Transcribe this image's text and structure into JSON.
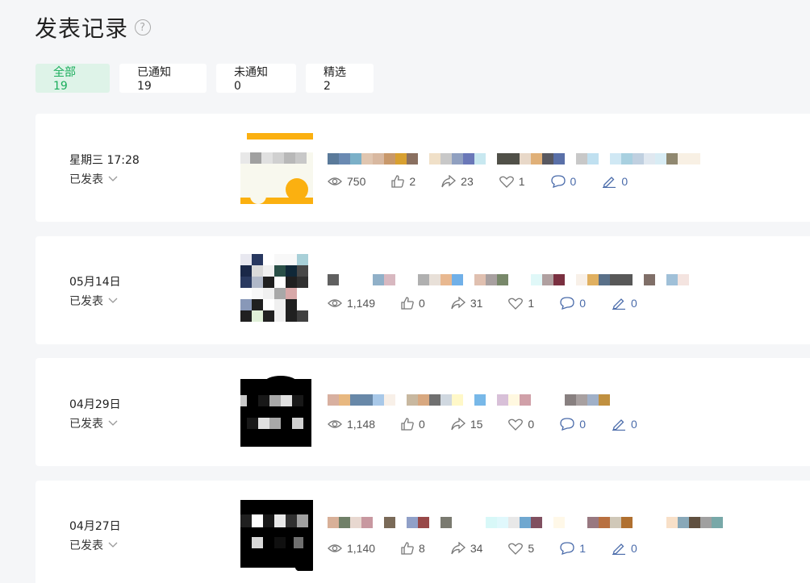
{
  "page": {
    "title": "发表记录",
    "help_glyph": "?"
  },
  "tabs": [
    {
      "label": "全部 19",
      "active": true
    },
    {
      "label": "已通知 19",
      "active": false
    },
    {
      "label": "未通知 0",
      "active": false
    },
    {
      "label": "精选 2",
      "active": false
    }
  ],
  "posts": [
    {
      "date": "星期三 17:28",
      "status": "已发表",
      "stats": {
        "views": "750",
        "likes": "2",
        "shares": "23",
        "favorites": "1",
        "comments": "0",
        "notes": "0"
      },
      "title_colors": [
        "#5a7a9a",
        "#6a8ab2",
        "#7bb0c8",
        "#e0c6b0",
        "#d8b8a0",
        "#c8986a",
        "#d8a030",
        "#8a7060",
        "#fff",
        "#f0e0c8",
        "#c8c8c8",
        "#90a0c0",
        "#6a78b8",
        "#c8e8f0",
        "#fff",
        "#505048",
        "#505048",
        "#e8d8c8",
        "#e0b078",
        "#585860",
        "#5a70a8",
        "#fff",
        "#c8c8c8",
        "#c0e0f0",
        "#fff",
        "#d0e8f4",
        "#a8d0e0",
        "#c0d0e0",
        "#e0e8f0",
        "#d8ecf4",
        "#908870",
        "#f8f0e4",
        "#f8f0e4"
      ]
    },
    {
      "date": "05月14日",
      "status": "已发表",
      "stats": {
        "views": "1,149",
        "likes": "0",
        "shares": "31",
        "favorites": "1",
        "comments": "0",
        "notes": "0"
      },
      "title_colors": [
        "#606060",
        "#fff",
        "#fff",
        "#fff",
        "#90b0c8",
        "#d8b8c0",
        "#fff",
        "#fff",
        "#b0b0b0",
        "#e8e0d8",
        "#e8b890",
        "#70b0e8",
        "#fff",
        "#e0c0b0",
        "#a8a0a0",
        "#78886a",
        "#fff",
        "#fff",
        "#e0f8f8",
        "#b0a0a0",
        "#7a3040",
        "#fff",
        "#f8f0e8",
        "#e0b060",
        "#5a7088",
        "#585858",
        "#585858",
        "#fff",
        "#806f68",
        "#fff",
        "#a0c0d8",
        "#f4e4e0"
      ]
    },
    {
      "date": "04月29日",
      "status": "已发表",
      "stats": {
        "views": "1,148",
        "likes": "0",
        "shares": "15",
        "favorites": "0",
        "comments": "0",
        "notes": "0"
      },
      "title_colors": [
        "#d8b0a0",
        "#e8b880",
        "#6888a8",
        "#6888a8",
        "#a8c8e8",
        "#f8f0e8",
        "#fff",
        "#c8b8a0",
        "#d8a880",
        "#707070",
        "#d0d8e0",
        "#fff8c8",
        "#fff",
        "#78b8e8",
        "#fff",
        "#d8c0d8",
        "#fff8e0",
        "#d0a0a8",
        "#fff",
        "#fff",
        "#fff",
        "#888080",
        "#a8a0a0",
        "#a0b0c8",
        "#c09040"
      ]
    },
    {
      "date": "04月27日",
      "status": "已发表",
      "stats": {
        "views": "1,140",
        "likes": "8",
        "shares": "34",
        "favorites": "5",
        "comments": "1",
        "notes": "0"
      },
      "title_colors": [
        "#d8b098",
        "#708068",
        "#e8d8d0",
        "#c898a0",
        "#fff",
        "#7a6a58",
        "#fff",
        "#90a0c8",
        "#984848",
        "#fff",
        "#7a7a70",
        "#fff",
        "#fff",
        "#fff",
        "#d8f8f8",
        "#e0f8fc",
        "#e8e8e8",
        "#70a8d0",
        "#805060",
        "#fff",
        "#fff8e8",
        "#fff",
        "#fff",
        "#987880",
        "#b87040",
        "#d0c8b8",
        "#b07030",
        "#fff",
        "#fff",
        "#fff",
        "#f8e0c8",
        "#88a8b8",
        "#605040",
        "#a0a0a0",
        "#78a8a8"
      ]
    }
  ],
  "colors": {
    "accent_green": "#1aad5b",
    "active_tab_bg": "#def3e8",
    "blue_stat": "#4a6baa",
    "background": "#f5f6f8"
  },
  "icons": [
    "help-icon",
    "eye-icon",
    "thumbs-up-icon",
    "share-icon",
    "heart-icon",
    "comment-icon",
    "pen-icon",
    "chevron-down-icon"
  ]
}
